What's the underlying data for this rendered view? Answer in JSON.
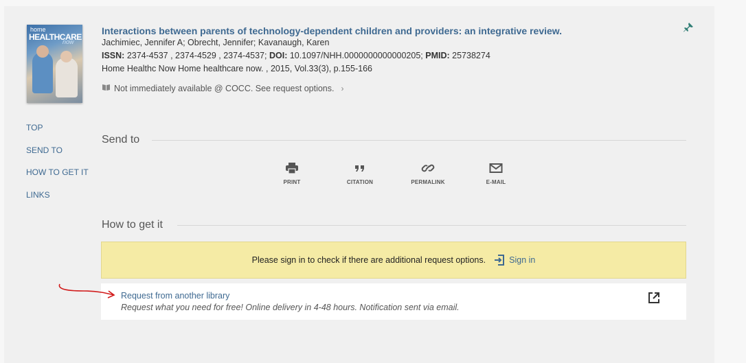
{
  "record": {
    "cover_text_small": "home",
    "cover_text_big": "HEALTHCARE",
    "cover_text_now": "now",
    "title": "Interactions between parents of technology-dependent children and providers: an integrative review.",
    "authors": "Jachimiec, Jennifer A; Obrecht, Jennifer; Kavanaugh, Karen",
    "issn_label": "ISSN:",
    "issn_value": "2374-4537 , 2374-4529 , 2374-4537;",
    "doi_label": "DOI:",
    "doi_value": "10.1097/NHH.0000000000000205;",
    "pmid_label": "PMID:",
    "pmid_value": "25738274",
    "source": "Home Healthc Now Home healthcare now. , 2015, Vol.33(3), p.155-166",
    "availability": "Not immediately available @ COCC. See request options."
  },
  "sidenav": {
    "items": [
      "TOP",
      "SEND TO",
      "HOW TO GET IT",
      "LINKS"
    ]
  },
  "send_to": {
    "heading": "Send to",
    "actions": [
      {
        "label": "PRINT",
        "icon": "print-icon"
      },
      {
        "label": "CITATION",
        "icon": "quote-icon"
      },
      {
        "label": "PERMALINK",
        "icon": "link-icon"
      },
      {
        "label": "E-MAIL",
        "icon": "mail-icon"
      }
    ]
  },
  "how_to_get": {
    "heading": "How to get it",
    "signin_message": "Please sign in to check if there are additional request options.",
    "signin_label": "Sign in",
    "request_link": "Request from another library",
    "request_desc": "Request what you need for free! Online delivery in 4-48 hours. Notification sent via email."
  },
  "colors": {
    "link": "#3e6991",
    "banner": "#f5eba5",
    "pin": "#2f7d74",
    "arrow": "#d11a1a"
  }
}
